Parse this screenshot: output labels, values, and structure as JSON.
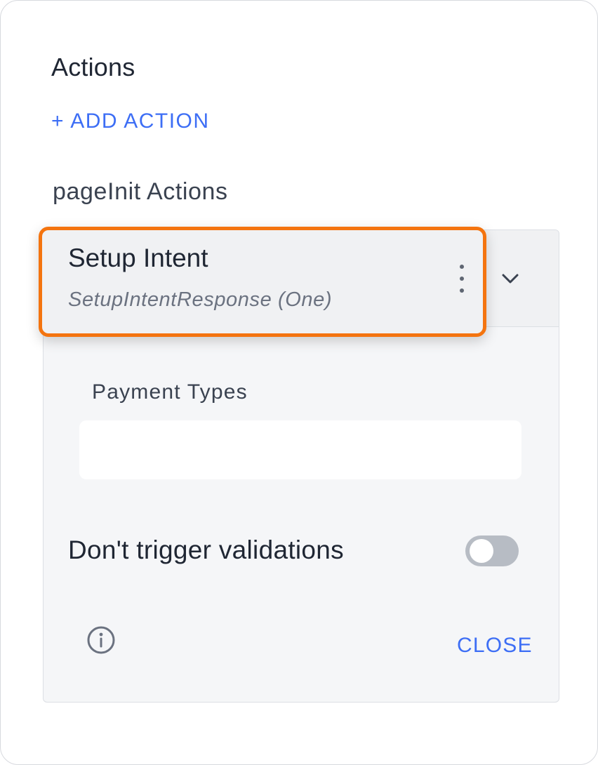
{
  "panel": {
    "title": "Actions",
    "add_action_label": "+ ADD ACTION",
    "group_title": "pageInit Actions"
  },
  "action": {
    "name": "Setup Intent",
    "subtitle": "SetupIntentResponse (One)",
    "menu_icon": "more-vertical-icon",
    "expand_icon": "chevron-down-icon",
    "highlight_color": "#f4740f"
  },
  "fields": {
    "payment_types_label": "Payment Types",
    "payment_types_value": ""
  },
  "toggle": {
    "label": "Don't trigger validations",
    "enabled": false
  },
  "footer": {
    "info_icon": "info-icon",
    "close_label": "CLOSE"
  },
  "colors": {
    "accent": "#3d6ef5",
    "text": "#1f2633"
  }
}
